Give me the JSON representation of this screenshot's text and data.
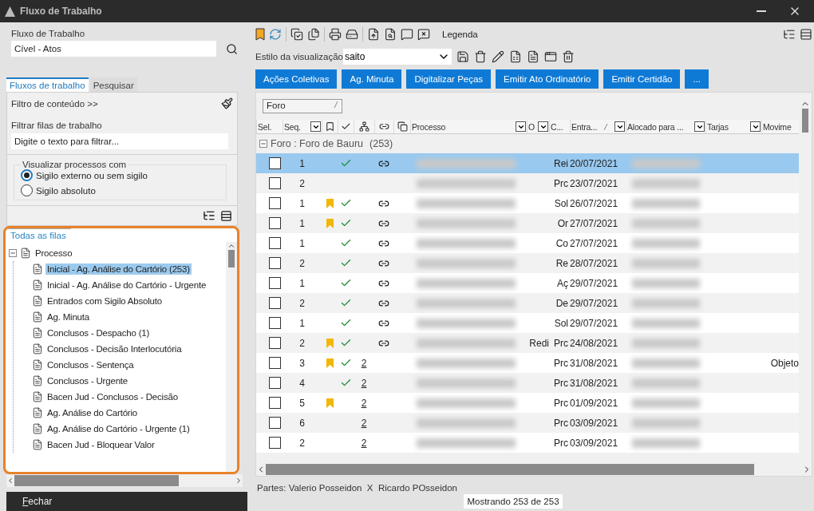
{
  "window": {
    "title": "Fluxo de Trabalho"
  },
  "left": {
    "workflow_label": "Fluxo de Trabalho",
    "workflow_value": "Cível - Atos",
    "tabs": [
      {
        "label": "Fluxos de trabalho",
        "selected": true
      },
      {
        "label": "Pesquisar",
        "selected": false
      }
    ],
    "content_filter": "Filtro de conteúdo >>",
    "queue_filter_label": "Filtrar filas de trabalho",
    "queue_filter_placeholder": "Digite o texto para filtrar...",
    "visibility": {
      "legend": "Visualizar processos com",
      "options": [
        {
          "label": "Sigilo externo ou sem sigilo",
          "selected": true
        },
        {
          "label": "Sigilo absoluto",
          "selected": false
        }
      ]
    },
    "queues_title": "Todas as filas",
    "tree": [
      {
        "label": "Processo",
        "expanded": true,
        "selected": false,
        "children": [
          {
            "label": "Inicial - Ag. Análise do Cartório (253)",
            "selected": true
          },
          {
            "label": "Inicial - Ag. Análise do Cartório - Urgente",
            "selected": false
          },
          {
            "label": "Entrados com Sigilo Absoluto",
            "selected": false
          },
          {
            "label": "Ag. Minuta",
            "selected": false
          },
          {
            "label": "Conclusos - Despacho (1)",
            "selected": false
          },
          {
            "label": "Conclusos - Decisão Interlocutória",
            "selected": false
          },
          {
            "label": "Conclusos - Sentença",
            "selected": false
          },
          {
            "label": "Conclusos - Urgente",
            "selected": false
          },
          {
            "label": "Bacen Jud - Conclusos - Decisão",
            "selected": false
          },
          {
            "label": "Ag. Análise do Cartório",
            "selected": false
          },
          {
            "label": "Ag. Análise do Cartório - Urgente (1)",
            "selected": false
          },
          {
            "label": "Bacen Jud - Bloquear Valor",
            "selected": false
          }
        ]
      }
    ],
    "close_button": "Fechar"
  },
  "toolbar": {
    "legend": "Legenda"
  },
  "view_style": {
    "label": "Estilo da visualização",
    "value": "saito"
  },
  "actions": [
    "Ações Coletivas",
    "Ag. Minuta",
    "Digitalizar Peças",
    "Emitir Ato Ordinatório",
    "Emitir Certidão",
    "..."
  ],
  "group_chip": "Foro",
  "columns": [
    {
      "kind": "text",
      "label": "Sel.",
      "filter": false,
      "sorted": false
    },
    {
      "kind": "text",
      "label": "Seq.",
      "filter": true,
      "sorted": false
    },
    {
      "kind": "icon"
    },
    {
      "kind": "icon"
    },
    {
      "kind": "icon"
    },
    {
      "kind": "icon"
    },
    {
      "kind": "icon"
    },
    {
      "kind": "text",
      "label": "Processo",
      "filter": true,
      "sorted": false
    },
    {
      "kind": "text",
      "label": "O",
      "filter": true,
      "sorted": false
    },
    {
      "kind": "text",
      "label": "C...",
      "filter": false,
      "sorted": false
    },
    {
      "kind": "text",
      "label": "Entra...",
      "filter": true,
      "sorted": true
    },
    {
      "kind": "text",
      "label": "Alocado para ...",
      "filter": true,
      "sorted": false
    },
    {
      "kind": "text",
      "label": "Tarjas",
      "filter": true,
      "sorted": false
    },
    {
      "kind": "text",
      "label": "Movime",
      "filter": false,
      "sorted": false
    }
  ],
  "group": {
    "label": "Foro : Foro de Bauru",
    "count": "(253)",
    "expanded": true
  },
  "rows": [
    {
      "selected": true,
      "checked": false,
      "seq": "1",
      "bookmark": false,
      "done": true,
      "link": {
        "kind": "chain"
      },
      "o": "",
      "c": "Rei",
      "date": "20/07/2021",
      "mov": ""
    },
    {
      "selected": false,
      "checked": false,
      "seq": "2",
      "bookmark": false,
      "done": false,
      "link": {
        "kind": "none"
      },
      "o": "",
      "c": "Prc",
      "date": "23/07/2021",
      "mov": ""
    },
    {
      "selected": false,
      "checked": false,
      "seq": "1",
      "bookmark": true,
      "done": true,
      "link": {
        "kind": "chain"
      },
      "o": "",
      "c": "Sol",
      "date": "26/07/2021",
      "mov": ""
    },
    {
      "selected": false,
      "checked": false,
      "seq": "1",
      "bookmark": true,
      "done": true,
      "link": {
        "kind": "chain"
      },
      "o": "",
      "c": "Or",
      "date": "27/07/2021",
      "mov": ""
    },
    {
      "selected": false,
      "checked": false,
      "seq": "1",
      "bookmark": false,
      "done": true,
      "link": {
        "kind": "chain"
      },
      "o": "",
      "c": "Co",
      "date": "27/07/2021",
      "mov": ""
    },
    {
      "selected": false,
      "checked": false,
      "seq": "2",
      "bookmark": false,
      "done": true,
      "link": {
        "kind": "chain"
      },
      "o": "",
      "c": "Re",
      "date": "28/07/2021",
      "mov": ""
    },
    {
      "selected": false,
      "checked": false,
      "seq": "1",
      "bookmark": false,
      "done": true,
      "link": {
        "kind": "chain"
      },
      "o": "",
      "c": "Aç",
      "date": "29/07/2021",
      "mov": ""
    },
    {
      "selected": false,
      "checked": false,
      "seq": "2",
      "bookmark": false,
      "done": true,
      "link": {
        "kind": "chain"
      },
      "o": "",
      "c": "De",
      "date": "29/07/2021",
      "mov": ""
    },
    {
      "selected": false,
      "checked": false,
      "seq": "1",
      "bookmark": false,
      "done": true,
      "link": {
        "kind": "chain"
      },
      "o": "",
      "c": "Sol",
      "date": "29/07/2021",
      "mov": ""
    },
    {
      "selected": false,
      "checked": false,
      "seq": "2",
      "bookmark": true,
      "done": true,
      "link": {
        "kind": "chain"
      },
      "o": "Redi",
      "c": "Prc",
      "date": "24/08/2021",
      "mov": ""
    },
    {
      "selected": false,
      "checked": false,
      "seq": "3",
      "bookmark": true,
      "done": true,
      "link": {
        "kind": "count",
        "text": "2"
      },
      "o": "",
      "c": "Prc",
      "date": "31/08/2021",
      "mov": "Objeto"
    },
    {
      "selected": false,
      "checked": false,
      "seq": "4",
      "bookmark": false,
      "done": true,
      "link": {
        "kind": "count",
        "text": "2"
      },
      "o": "",
      "c": "Prc",
      "date": "31/08/2021",
      "mov": ""
    },
    {
      "selected": false,
      "checked": false,
      "seq": "5",
      "bookmark": true,
      "done": false,
      "link": {
        "kind": "count",
        "text": "2"
      },
      "o": "",
      "c": "Prc",
      "date": "01/09/2021",
      "mov": ""
    },
    {
      "selected": false,
      "checked": false,
      "seq": "6",
      "bookmark": false,
      "done": false,
      "link": {
        "kind": "count",
        "text": "2"
      },
      "o": "",
      "c": "Prc",
      "date": "03/09/2021",
      "mov": ""
    },
    {
      "selected": false,
      "checked": false,
      "seq": "2",
      "bookmark": false,
      "done": false,
      "link": {
        "kind": "count",
        "text": "2"
      },
      "o": "",
      "c": "Prc",
      "date": "03/09/2021",
      "mov": ""
    }
  ],
  "parties": "Partes: Valerio Posseidon  X  Ricardo POsseidon",
  "status": "Mostrando 253 de 253"
}
